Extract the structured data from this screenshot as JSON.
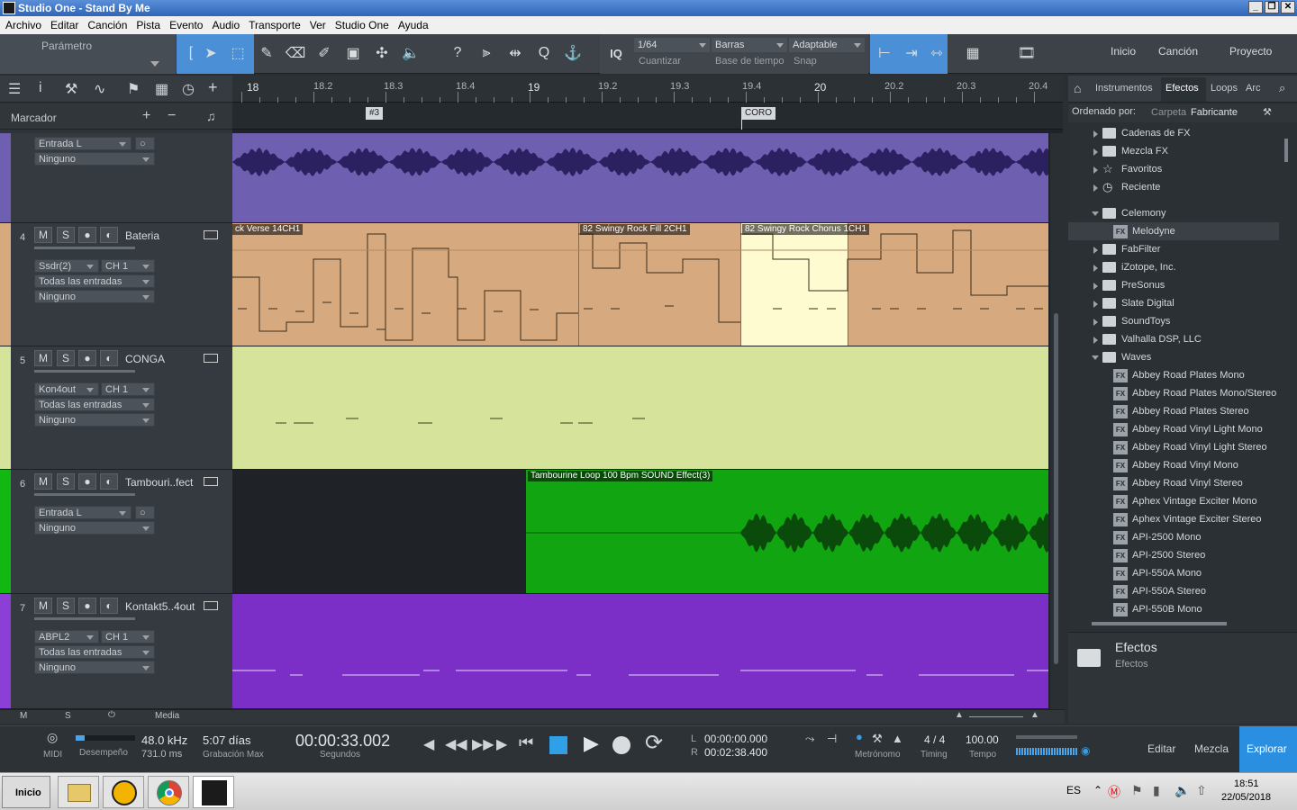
{
  "window": {
    "title": "Studio One - Stand By Me"
  },
  "menu": [
    "Archivo",
    "Editar",
    "Canción",
    "Pista",
    "Evento",
    "Audio",
    "Transporte",
    "Ver",
    "Studio One",
    "Ayuda"
  ],
  "toolbar": {
    "param_label": "Parámetro",
    "quantize": {
      "value": "1/64",
      "label": "Cuantizar"
    },
    "timebase": {
      "value": "Barras",
      "label": "Base de tiempo"
    },
    "snap": {
      "value": "Adaptable",
      "label": "Snap"
    },
    "iq": "IQ",
    "help": "?",
    "nav": [
      "Inicio",
      "Canción",
      "Proyecto"
    ]
  },
  "marker_lane": {
    "label": "Marcador"
  },
  "ruler": {
    "labels": [
      "18",
      "18.2",
      "18.3",
      "18.4",
      "19",
      "19.2",
      "19.3",
      "19.4",
      "20",
      "20.2",
      "20.3",
      "20.4"
    ]
  },
  "markers": [
    "#3",
    "CORO"
  ],
  "tracks": [
    {
      "num": "",
      "name": "",
      "input": "Entrada L",
      "output": "Ninguno",
      "color": "#6f5fb0"
    },
    {
      "num": "4",
      "name": "Bateria",
      "input": "Ssdr(2)",
      "channel": "CH 1",
      "input2": "Todas las entradas",
      "output": "Ninguno",
      "color": "#d6a97e"
    },
    {
      "num": "5",
      "name": "CONGA",
      "input": "Kon4out",
      "channel": "CH 1",
      "input2": "Todas las entradas",
      "output": "Ninguno",
      "color": "#d6e39a"
    },
    {
      "num": "6",
      "name": "Tambouri..fect",
      "input": "Entrada L",
      "output": "Ninguno",
      "color": "#11b811"
    },
    {
      "num": "7",
      "name": "Kontakt5..4out",
      "input": "ABPL2",
      "channel": "CH 1",
      "input2": "Todas las entradas",
      "output": "Ninguno",
      "color": "#8b3fd6"
    }
  ],
  "btn": {
    "m": "M",
    "s": "S"
  },
  "clips": [
    "ck Verse 14CH1",
    "82 Swingy Rock Fill 2CH1",
    "82 Swingy Rock Chorus 1CH1",
    "Tambourine Loop 100 Bpm SOUND Effect(3)"
  ],
  "browser": {
    "tabs": [
      "Instrumentos",
      "Efectos",
      "Loops",
      "Arc"
    ],
    "sort_label": "Ordenado por:",
    "sort_options": [
      "Carpeta",
      "Fabricante"
    ],
    "items": [
      {
        "label": "Cadenas de FX",
        "type": "folder",
        "indent": 0,
        "open": false
      },
      {
        "label": "Mezcla FX",
        "type": "folder",
        "indent": 0,
        "open": false
      },
      {
        "label": "Favoritos",
        "type": "star",
        "indent": 0,
        "open": false
      },
      {
        "label": "Reciente",
        "type": "clock",
        "indent": 0,
        "open": false
      },
      {
        "label": "Celemony",
        "type": "folder",
        "indent": 0,
        "open": true,
        "gap": true
      },
      {
        "label": "Melodyne",
        "type": "fx",
        "indent": 1,
        "selected": true
      },
      {
        "label": "FabFilter",
        "type": "folder",
        "indent": 0,
        "open": false
      },
      {
        "label": "iZotope, Inc.",
        "type": "folder",
        "indent": 0,
        "open": false
      },
      {
        "label": "PreSonus",
        "type": "folder",
        "indent": 0,
        "open": false
      },
      {
        "label": "Slate Digital",
        "type": "folder",
        "indent": 0,
        "open": false
      },
      {
        "label": "SoundToys",
        "type": "folder",
        "indent": 0,
        "open": false
      },
      {
        "label": "Valhalla DSP, LLC",
        "type": "folder",
        "indent": 0,
        "open": false
      },
      {
        "label": "Waves",
        "type": "folder",
        "indent": 0,
        "open": true
      },
      {
        "label": "Abbey Road Plates Mono",
        "type": "fx",
        "indent": 1
      },
      {
        "label": "Abbey Road Plates Mono/Stereo",
        "type": "fx",
        "indent": 1
      },
      {
        "label": "Abbey Road Plates Stereo",
        "type": "fx",
        "indent": 1
      },
      {
        "label": "Abbey Road Vinyl Light Mono",
        "type": "fx",
        "indent": 1
      },
      {
        "label": "Abbey Road Vinyl Light Stereo",
        "type": "fx",
        "indent": 1
      },
      {
        "label": "Abbey Road Vinyl Mono",
        "type": "fx",
        "indent": 1
      },
      {
        "label": "Abbey Road Vinyl Stereo",
        "type": "fx",
        "indent": 1
      },
      {
        "label": "Aphex Vintage Exciter Mono",
        "type": "fx",
        "indent": 1
      },
      {
        "label": "Aphex Vintage Exciter Stereo",
        "type": "fx",
        "indent": 1
      },
      {
        "label": "API-2500 Mono",
        "type": "fx",
        "indent": 1
      },
      {
        "label": "API-2500 Stereo",
        "type": "fx",
        "indent": 1
      },
      {
        "label": "API-550A Mono",
        "type": "fx",
        "indent": 1
      },
      {
        "label": "API-550A Stereo",
        "type": "fx",
        "indent": 1
      },
      {
        "label": "API-550B Mono",
        "type": "fx",
        "indent": 1
      }
    ],
    "footer": {
      "title": "Efectos",
      "subtitle": "Efectos"
    }
  },
  "bottom": {
    "m": "M",
    "s": "S",
    "media": "Media"
  },
  "transport": {
    "midi": "MIDI",
    "perf": "Desempeño",
    "rate": "48.0 kHz",
    "latency": "731.0 ms",
    "rec_days": "5:07 días",
    "rec_label": "Grabación Max",
    "time": "00:00:33.002",
    "time_unit": "Segundos",
    "l_label": "L",
    "r_label": "R",
    "l_time": "00:00:00.000",
    "r_time": "00:02:38.400",
    "metronome": "Metrónomo",
    "sig": "4 / 4",
    "sig_label": "Timing",
    "tempo": "100.00",
    "tempo_label": "Tempo",
    "views": [
      "Editar",
      "Mezcla",
      "Explorar"
    ]
  },
  "taskbar": {
    "start": "Inicio",
    "lang": "ES",
    "time": "18:51",
    "date": "22/05/2018"
  }
}
